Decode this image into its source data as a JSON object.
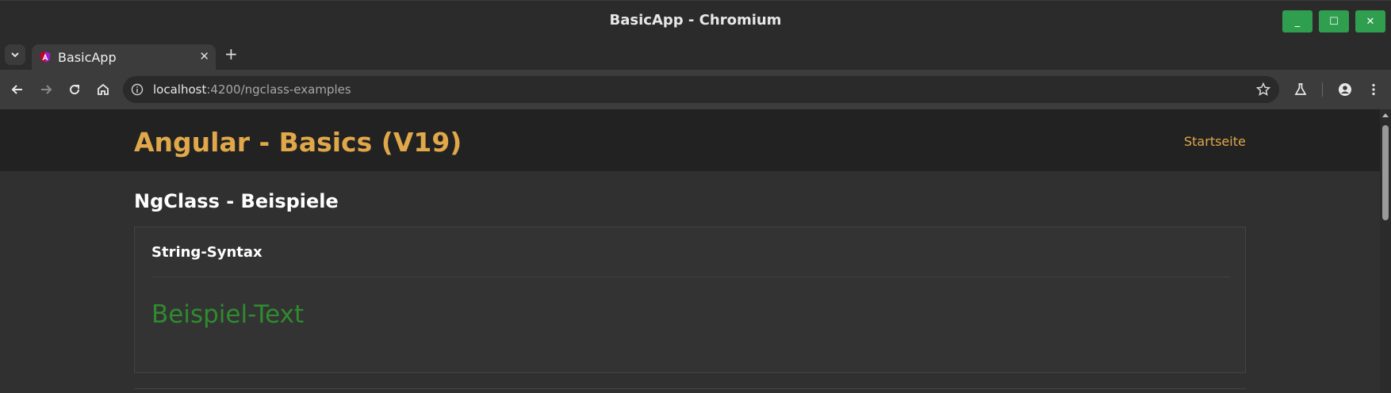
{
  "window": {
    "title": "BasicApp - Chromium",
    "minimize_label": "_",
    "maximize_label": "☐",
    "close_label": "✕"
  },
  "tabs": [
    {
      "label": "BasicApp",
      "favicon": "angular-logo-icon",
      "close_label": "✕"
    }
  ],
  "tabstrip": {
    "search_label": "⌄",
    "new_tab_label": "+"
  },
  "toolbar": {
    "url_host": "localhost",
    "url_rest": ":4200/ngclass-examples"
  },
  "page": {
    "brand": "Angular - Basics (V19)",
    "nav_link": "Startseite",
    "heading": "NgClass - Beispiele",
    "card": {
      "title": "String-Syntax",
      "demo_text": "Beispiel-Text"
    }
  },
  "colors": {
    "accent": "#e0a84a",
    "demo_green": "#2e8b2e",
    "window_button": "#2f9e4f"
  }
}
